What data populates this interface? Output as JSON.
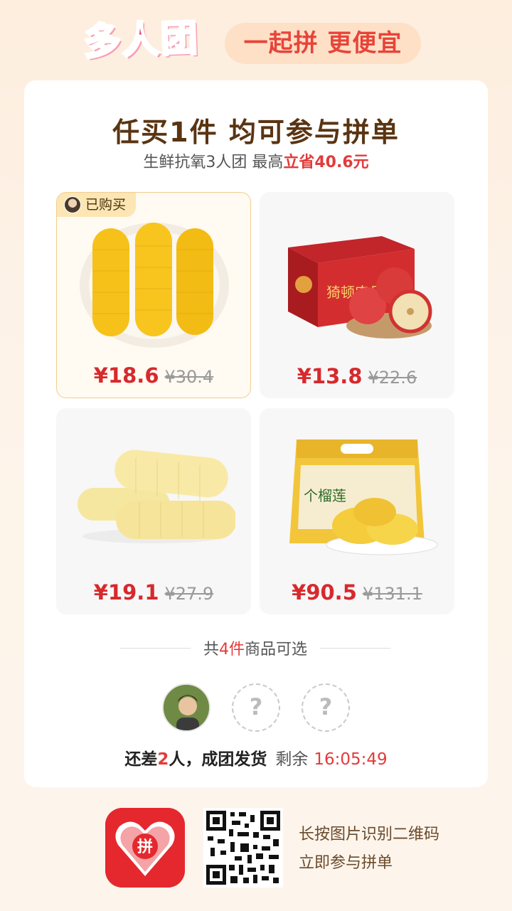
{
  "header": {
    "logo_text": "多人团",
    "slogan": "一起拼 更便宜"
  },
  "card": {
    "title": "任买1件 均可参与拼单",
    "subtitle_prefix": "生鲜抗氧3人团 最高",
    "subtitle_highlight": "立省40.6元"
  },
  "products": [
    {
      "badge": "已购买",
      "price": "¥18.6",
      "original_price": "¥30.4",
      "image": "yellow-corn-plate"
    },
    {
      "price": "¥13.8",
      "original_price": "¥22.6",
      "image": "apple-gift-box",
      "box_text": "猗顿农品"
    },
    {
      "price": "¥19.1",
      "original_price": "¥27.9",
      "image": "white-corn"
    },
    {
      "price": "¥90.5",
      "original_price": "¥131.1",
      "image": "durian-bag",
      "bag_text": "个榴莲"
    }
  ],
  "selection": {
    "prefix": "共",
    "count": "4件",
    "suffix": "商品可选"
  },
  "group": {
    "empty_slot_symbol": "?",
    "status_prefix": "还差",
    "needed": "2",
    "status_suffix": "人，成团发货",
    "remaining_label": "剩余",
    "timer": "16:05:49"
  },
  "footer": {
    "app_icon_text": "拼",
    "line1": "长按图片识别二维码",
    "line2": "立即参与拼单"
  },
  "colors": {
    "accent_red": "#e23b3b",
    "brand_pink": "#f23d6e",
    "title_brown": "#5a3412"
  }
}
